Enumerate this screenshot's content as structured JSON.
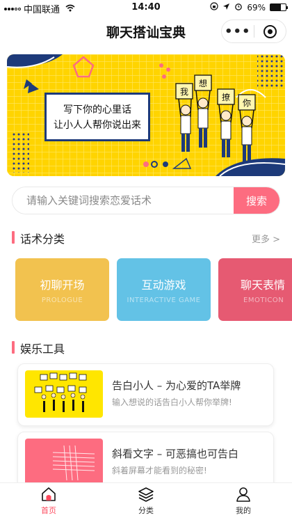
{
  "status": {
    "carrier": "中国联通",
    "time": "14:40",
    "battery": "69%",
    "battery_level": 0.69
  },
  "nav": {
    "title": "聊天搭讪宝典",
    "more_label": "•••"
  },
  "banner": {
    "line1": "写下你的心里话",
    "line2": "让小人人帮你说出来",
    "sign_chars": [
      "我",
      "想",
      "撩",
      "你"
    ]
  },
  "search": {
    "placeholder": "请输入关键词搜索恋爱话术",
    "button_label": "搜索"
  },
  "category_section": {
    "title": "话术分类",
    "more_label": "更多 >",
    "items": [
      {
        "name": "初聊开场",
        "en": "PROLOGUE",
        "color": "#f2c24f"
      },
      {
        "name": "互动游戏",
        "en": "INTERACTIVE GAME",
        "color": "#63c2e6"
      },
      {
        "name": "聊天表情",
        "en": "EMOTICON",
        "color": "#e65a72"
      }
    ]
  },
  "tools_section": {
    "title": "娱乐工具",
    "items": [
      {
        "title": "告白小人 – 为心爱的TA举牌",
        "desc": "输入想说的话告白小人帮你举牌!",
        "color": "#ffe600"
      },
      {
        "title": "斜看文字 – 可恶搞也可告白",
        "desc": "斜着屏幕才能看到的秘密!",
        "color": "#fd6c80"
      }
    ]
  },
  "tabbar": {
    "items": [
      {
        "label": "首页",
        "icon": "home-icon",
        "active": true
      },
      {
        "label": "分类",
        "icon": "layers-icon",
        "active": false
      },
      {
        "label": "我的",
        "icon": "user-icon",
        "active": false
      }
    ]
  },
  "colors": {
    "accent": "#fd6c80",
    "active_tab": "#fd4a5e",
    "banner_yellow": "#ffd400",
    "banner_navy": "#1d3a7a"
  }
}
